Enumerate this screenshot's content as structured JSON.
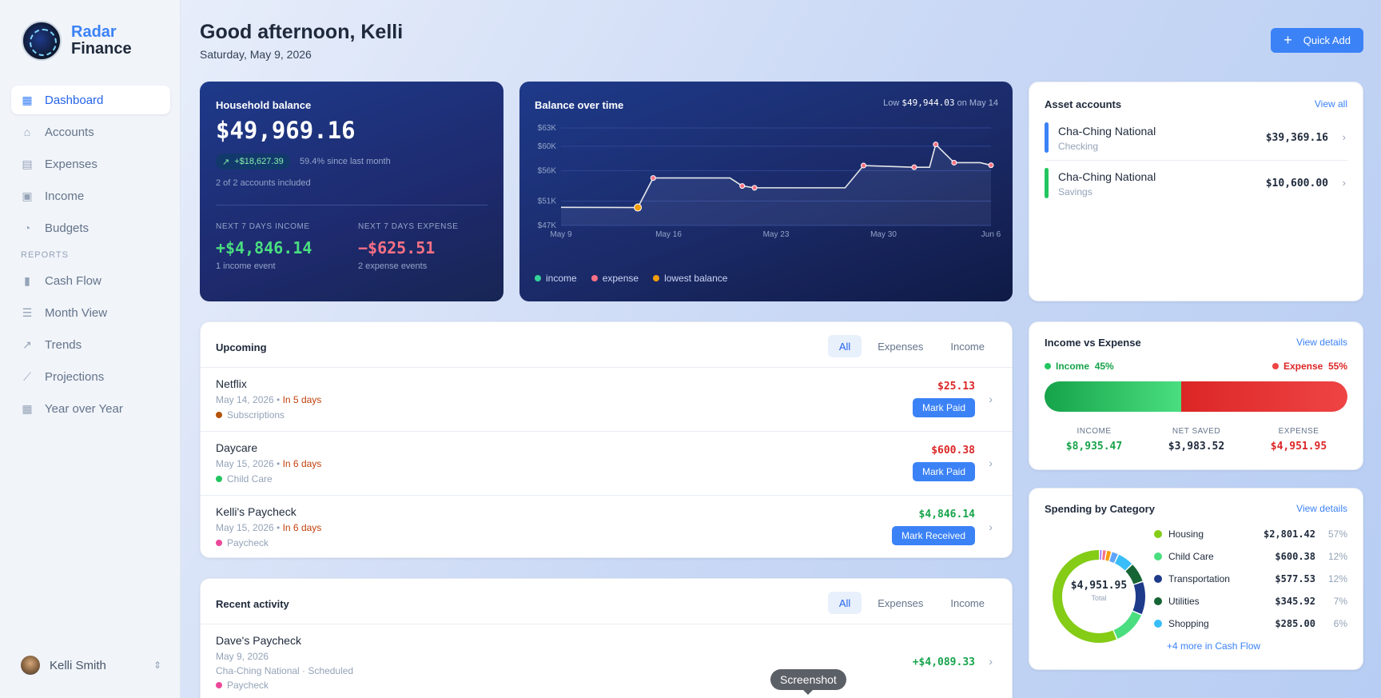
{
  "app": {
    "name_line1": "Radar",
    "name_line2": "Finance"
  },
  "nav": {
    "items": [
      {
        "label": "Dashboard",
        "icon": "dashboard-icon",
        "active": true
      },
      {
        "label": "Accounts",
        "icon": "bank-icon"
      },
      {
        "label": "Expenses",
        "icon": "receipt-icon"
      },
      {
        "label": "Income",
        "icon": "wallet-icon"
      },
      {
        "label": "Budgets",
        "icon": "piggy-bank-icon"
      }
    ],
    "section_label": "REPORTS",
    "reports": [
      {
        "label": "Cash Flow",
        "icon": "bar-chart-icon"
      },
      {
        "label": "Month View",
        "icon": "list-icon"
      },
      {
        "label": "Trends",
        "icon": "trend-up-icon"
      },
      {
        "label": "Projections",
        "icon": "line-chart-icon"
      },
      {
        "label": "Year over Year",
        "icon": "calendar-icon"
      }
    ]
  },
  "user": {
    "name": "Kelli Smith"
  },
  "header": {
    "greeting": "Good afternoon, Kelli",
    "date": "Saturday, May 9, 2026",
    "quick_add": "Quick Add"
  },
  "household": {
    "title": "Household balance",
    "amount": "$49,969.16",
    "change": "+$18,627.39",
    "change_note": "59.4% since last month",
    "accounts_note": "2 of 2 accounts included",
    "income_label": "NEXT 7 DAYS INCOME",
    "income_value": "+$4,846.14",
    "income_note": "1 income event",
    "expense_label": "NEXT 7 DAYS EXPENSE",
    "expense_value": "−$625.51",
    "expense_note": "2 expense events"
  },
  "balance_chart": {
    "title": "Balance over time",
    "low_prefix": "Low",
    "low_value": "$49,944.03",
    "low_suffix": "on May 14",
    "legend": [
      "income",
      "expense",
      "lowest balance"
    ]
  },
  "chart_data": {
    "type": "line",
    "title": "Balance over time",
    "x_ticks": [
      "May 9",
      "May 16",
      "May 23",
      "May 30",
      "Jun 6"
    ],
    "y_ticks": [
      "$63K",
      "$60K",
      "$56K",
      "$51K",
      "$47K"
    ],
    "ylim": [
      47000,
      63000
    ],
    "xlim": [
      0,
      28
    ],
    "line": [
      {
        "x": 0,
        "y": 49969
      },
      {
        "x": 5,
        "y": 49944
      },
      {
        "x": 6,
        "y": 54790
      },
      {
        "x": 11,
        "y": 54790
      },
      {
        "x": 11.8,
        "y": 53480
      },
      {
        "x": 12.6,
        "y": 53180
      },
      {
        "x": 18.5,
        "y": 53180
      },
      {
        "x": 19.7,
        "y": 56830
      },
      {
        "x": 23,
        "y": 56550
      },
      {
        "x": 24,
        "y": 56550
      },
      {
        "x": 24.4,
        "y": 60290
      },
      {
        "x": 25.6,
        "y": 57300
      },
      {
        "x": 27.3,
        "y": 57300
      },
      {
        "x": 28,
        "y": 56880
      }
    ],
    "markers": [
      {
        "x": 5,
        "y": 49944,
        "type": "lowest balance"
      },
      {
        "x": 6,
        "y": 54790,
        "type": "expense"
      },
      {
        "x": 11.8,
        "y": 53480,
        "type": "expense"
      },
      {
        "x": 12.6,
        "y": 53180,
        "type": "expense"
      },
      {
        "x": 19.7,
        "y": 56830,
        "type": "expense"
      },
      {
        "x": 23,
        "y": 56550,
        "type": "expense"
      },
      {
        "x": 24.4,
        "y": 60290,
        "type": "expense"
      },
      {
        "x": 25.6,
        "y": 57300,
        "type": "expense"
      },
      {
        "x": 28,
        "y": 56880,
        "type": "expense"
      }
    ],
    "grid": true
  },
  "assets": {
    "title": "Asset accounts",
    "link": "View all",
    "items": [
      {
        "name": "Cha-Ching National",
        "sub": "Checking",
        "value": "$39,369.16",
        "color": "#3b82f6"
      },
      {
        "name": "Cha-Ching National",
        "sub": "Savings",
        "value": "$10,600.00",
        "color": "#22c55e"
      }
    ]
  },
  "upcoming": {
    "title": "Upcoming",
    "tabs": [
      "All",
      "Expenses",
      "Income"
    ],
    "rows": [
      {
        "name": "Netflix",
        "date": "May 14, 2026",
        "due": "In 5 days",
        "category": "Subscriptions",
        "cat_color": "#b45309",
        "amount": "$25.13",
        "amount_type": "red",
        "action": "Mark Paid"
      },
      {
        "name": "Daycare",
        "date": "May 15, 2026",
        "due": "In 6 days",
        "category": "Child Care",
        "cat_color": "#22c55e",
        "amount": "$600.38",
        "amount_type": "red",
        "action": "Mark Paid"
      },
      {
        "name": "Kelli's Paycheck",
        "date": "May 15, 2026",
        "due": "In 6 days",
        "category": "Paycheck",
        "cat_color": "#ec4899",
        "amount": "$4,846.14",
        "amount_type": "green",
        "action": "Mark Received"
      }
    ]
  },
  "recent": {
    "title": "Recent activity",
    "tabs": [
      "All",
      "Expenses",
      "Income"
    ],
    "rows": [
      {
        "name": "Dave's Paycheck",
        "date": "May 9, 2026",
        "account": "Cha-Ching National · Scheduled",
        "category": "Paycheck",
        "cat_color": "#ec4899",
        "amount": "+$4,089.33"
      }
    ]
  },
  "income_expense": {
    "title": "Income vs Expense",
    "link": "View details",
    "income_label": "Income",
    "income_pct": "45%",
    "expense_label": "Expense",
    "expense_pct": "55%",
    "income_share": 0.45,
    "stats": [
      {
        "label": "INCOME",
        "value": "$8,935.47",
        "color": "#16a34a"
      },
      {
        "label": "NET SAVED",
        "value": "$3,983.52",
        "color": "#1e293b"
      },
      {
        "label": "EXPENSE",
        "value": "$4,951.95",
        "color": "#dc2626"
      }
    ]
  },
  "spending": {
    "title": "Spending by Category",
    "link": "View details",
    "total": "$4,951.95",
    "total_label": "Total",
    "more": "+4 more in Cash Flow",
    "categories": [
      {
        "name": "Housing",
        "value": "$2,801.42",
        "pct": "57%",
        "share": 0.566,
        "color": "#84cc16"
      },
      {
        "name": "Child Care",
        "value": "$600.38",
        "pct": "12%",
        "share": 0.121,
        "color": "#4ade80"
      },
      {
        "name": "Transportation",
        "value": "$577.53",
        "pct": "12%",
        "share": 0.117,
        "color": "#1e3a8a"
      },
      {
        "name": "Utilities",
        "value": "$345.92",
        "pct": "7%",
        "share": 0.07,
        "color": "#166534"
      },
      {
        "name": "Shopping",
        "value": "$285.00",
        "pct": "6%",
        "share": 0.058,
        "color": "#38bdf8"
      }
    ],
    "other_segments": [
      {
        "share": 0.025,
        "color": "#60a5fa"
      },
      {
        "share": 0.018,
        "color": "#f59e0b"
      },
      {
        "share": 0.014,
        "color": "#fb7185"
      },
      {
        "share": 0.011,
        "color": "#a78bfa"
      }
    ]
  },
  "tooltip": {
    "text": "Screenshot"
  }
}
